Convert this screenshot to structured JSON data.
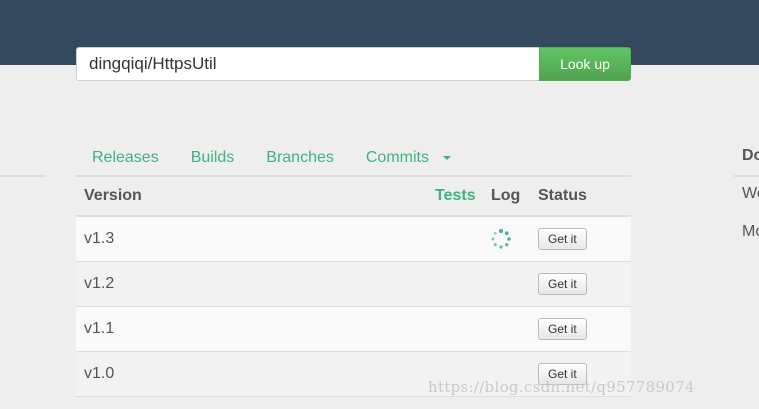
{
  "search": {
    "value": "dingqiqi/HttpsUtil",
    "button_label": "Look up"
  },
  "tabs": [
    {
      "label": "Releases"
    },
    {
      "label": "Builds"
    },
    {
      "label": "Branches"
    },
    {
      "label": "Commits"
    }
  ],
  "table": {
    "headers": {
      "version": "Version",
      "tests": "Tests",
      "log": "Log",
      "status": "Status"
    },
    "rows": [
      {
        "version": "v1.3",
        "status_button": "Get it",
        "loading": true
      },
      {
        "version": "v1.2",
        "status_button": "Get it",
        "loading": false
      },
      {
        "version": "v1.1",
        "status_button": "Get it",
        "loading": false
      },
      {
        "version": "v1.0",
        "status_button": "Get it",
        "loading": false
      }
    ]
  },
  "right_panel": {
    "title": "Do",
    "items": [
      "We",
      "Mo"
    ]
  },
  "watermark": "https://blog.csdn.net/q957789074",
  "colors": {
    "topbar": "#34495e",
    "accent": "#3fb27f",
    "button_green": "#5cb85c"
  }
}
